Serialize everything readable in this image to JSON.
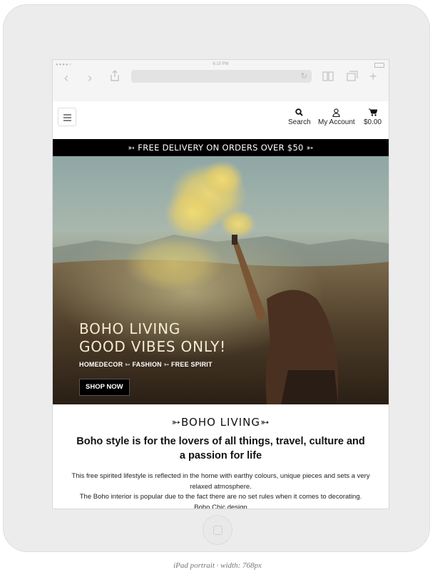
{
  "device": {
    "caption": "iPad portrait · width: 768px",
    "status_time": "6:10 PM"
  },
  "browser": {
    "back_icon": "chevron-left-icon",
    "forward_icon": "chevron-right-icon",
    "share_icon": "share-icon",
    "reload_icon": "reload-icon",
    "reader_icon": "book-icon",
    "tabs_icon": "tabs-icon",
    "new_tab_icon": "plus-icon"
  },
  "header": {
    "search_label": "Search",
    "account_label": "My Account",
    "cart_label": "$0.00"
  },
  "promo": {
    "text": "➳ FREE DELIVERY ON ORDERS OVER $50 ➳"
  },
  "hero": {
    "title_line1": "BOHO LIVING",
    "title_line2": "GOOD VIBES ONLY!",
    "subtitle": "HOMEDECOR ➳ FASHION ➳ FREE SPIRIT",
    "button": "SHOP NOW"
  },
  "main": {
    "section_title": "➳BOHO LIVING➳",
    "headline": "Boho style is for the lovers of all things, travel, culture and a passion for life",
    "paragraph1": "This free spirited lifestyle is reflected in the home with earthy colours, unique pieces and sets a very relaxed atmosphere.",
    "paragraph2": "The Boho interior is popular due to the fact there are no set rules when it comes to decorating.",
    "paragraph3": "Boho Chic design"
  },
  "colors": {
    "accent": "#000000",
    "hero_text": "#f3ecd2",
    "smoke": "#e8d36a"
  }
}
